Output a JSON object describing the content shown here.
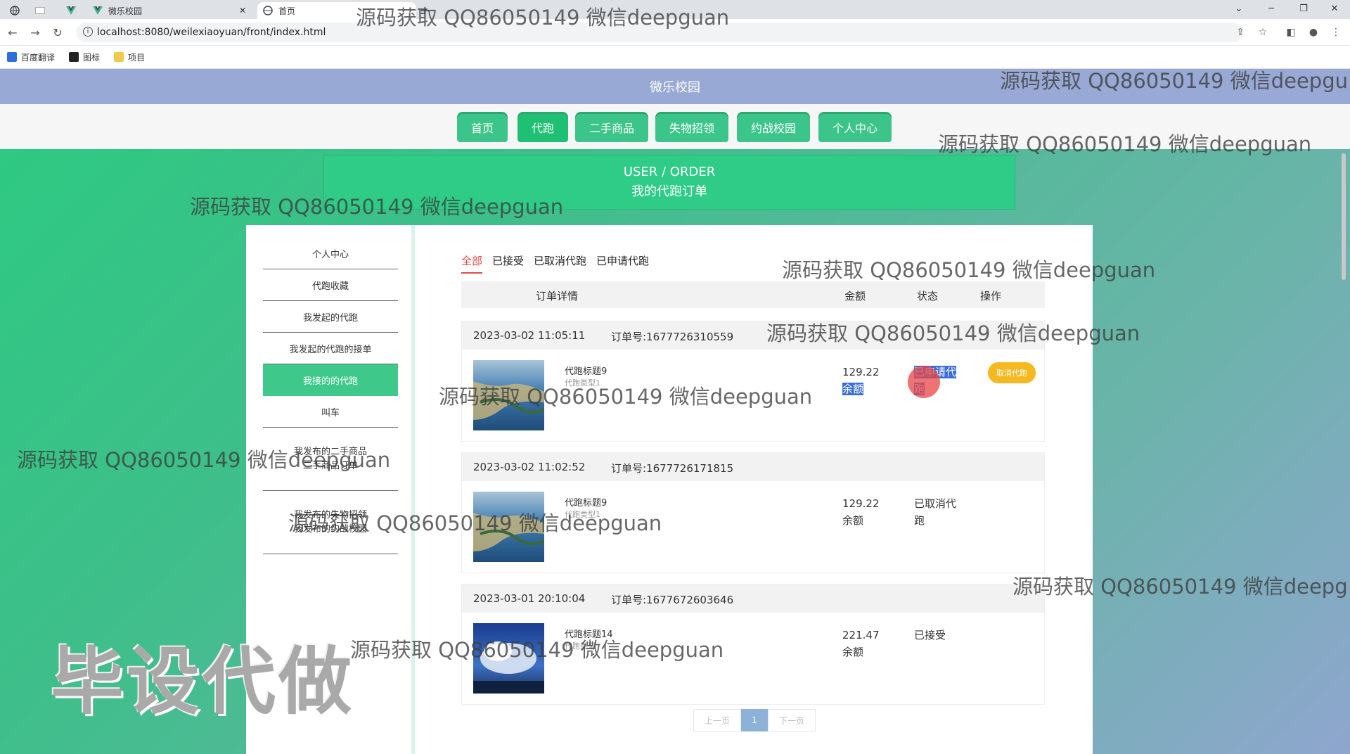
{
  "browser": {
    "tabs": [
      {
        "title": "",
        "active": false
      },
      {
        "title": "",
        "active": false
      },
      {
        "title": "微乐校园",
        "active": false
      },
      {
        "title": "首页",
        "active": true
      }
    ],
    "url": "localhost:8080/weilexiaoyuan/front/index.html",
    "bookmarks": [
      {
        "label": "百度翻译",
        "color": "#2a6fdb"
      },
      {
        "label": "图标",
        "color": "#222222"
      },
      {
        "label": "项目",
        "color": "#f2c94c"
      }
    ]
  },
  "site": {
    "title": "微乐校园",
    "menu": [
      "首页",
      "代跑",
      "二手商品",
      "失物招领",
      "约战校园",
      "个人中心"
    ],
    "active_menu": "代跑",
    "banner": {
      "en": "USER / ORDER",
      "cn": "我的代跑订单"
    }
  },
  "sidebar": [
    "个人中心",
    "代跑收藏",
    "我发起的代跑",
    "我发起的代跑的接单",
    "我接的的代跑",
    "叫车",
    "我发布的二手商品",
    "二手商品订单",
    "我发布的失物招领",
    "我发布的约战校园"
  ],
  "sidebar_active": "我接的的代跑",
  "order_tabs": [
    "全部",
    "已接受",
    "已取消代跑",
    "已申请代跑"
  ],
  "order_tabs_active": "全部",
  "table_headers": {
    "detail": "订单详情",
    "amount": "金额",
    "status": "状态",
    "action": "操作"
  },
  "orders": [
    {
      "time": "2023-03-02 11:05:11",
      "order_no": "订单号:1677726310559",
      "title": "代跑标题9",
      "type": "代跑类型1",
      "amount": "129.22",
      "pay": "余额",
      "status": "已申请代跑",
      "action": "取消代跑",
      "image": "coast-aerial"
    },
    {
      "time": "2023-03-02 11:02:52",
      "order_no": "订单号:1677726171815",
      "title": "代跑标题9",
      "type": "代跑类型1",
      "amount": "129.22",
      "pay": "余额",
      "status": "已取消代跑",
      "action": "",
      "image": "coast-aerial"
    },
    {
      "time": "2023-03-01 20:10:04",
      "order_no": "订单号:1677672603646",
      "title": "代跑标题14",
      "type": "代跑类型",
      "amount": "221.47",
      "pay": "余额",
      "status": "已接受",
      "action": "",
      "image": "sky-clouds"
    }
  ],
  "pager": {
    "prev": "上一页",
    "current": "1",
    "next": "下一页"
  },
  "watermarks": {
    "text": "源码获取 QQ86050149 微信deepguan",
    "cut_long": "源码获取 QQ86050149 微信deepgu",
    "cut_short": "源码获取 QQ86050149 微信deepg",
    "big": "毕设代做"
  },
  "colors": {
    "header": "#97a9d4",
    "menu": "#3cc58a",
    "accent": "#2ecc87",
    "danger": "#e14a4a",
    "warning": "#f5b81e",
    "pager": "#8eb2d7"
  }
}
